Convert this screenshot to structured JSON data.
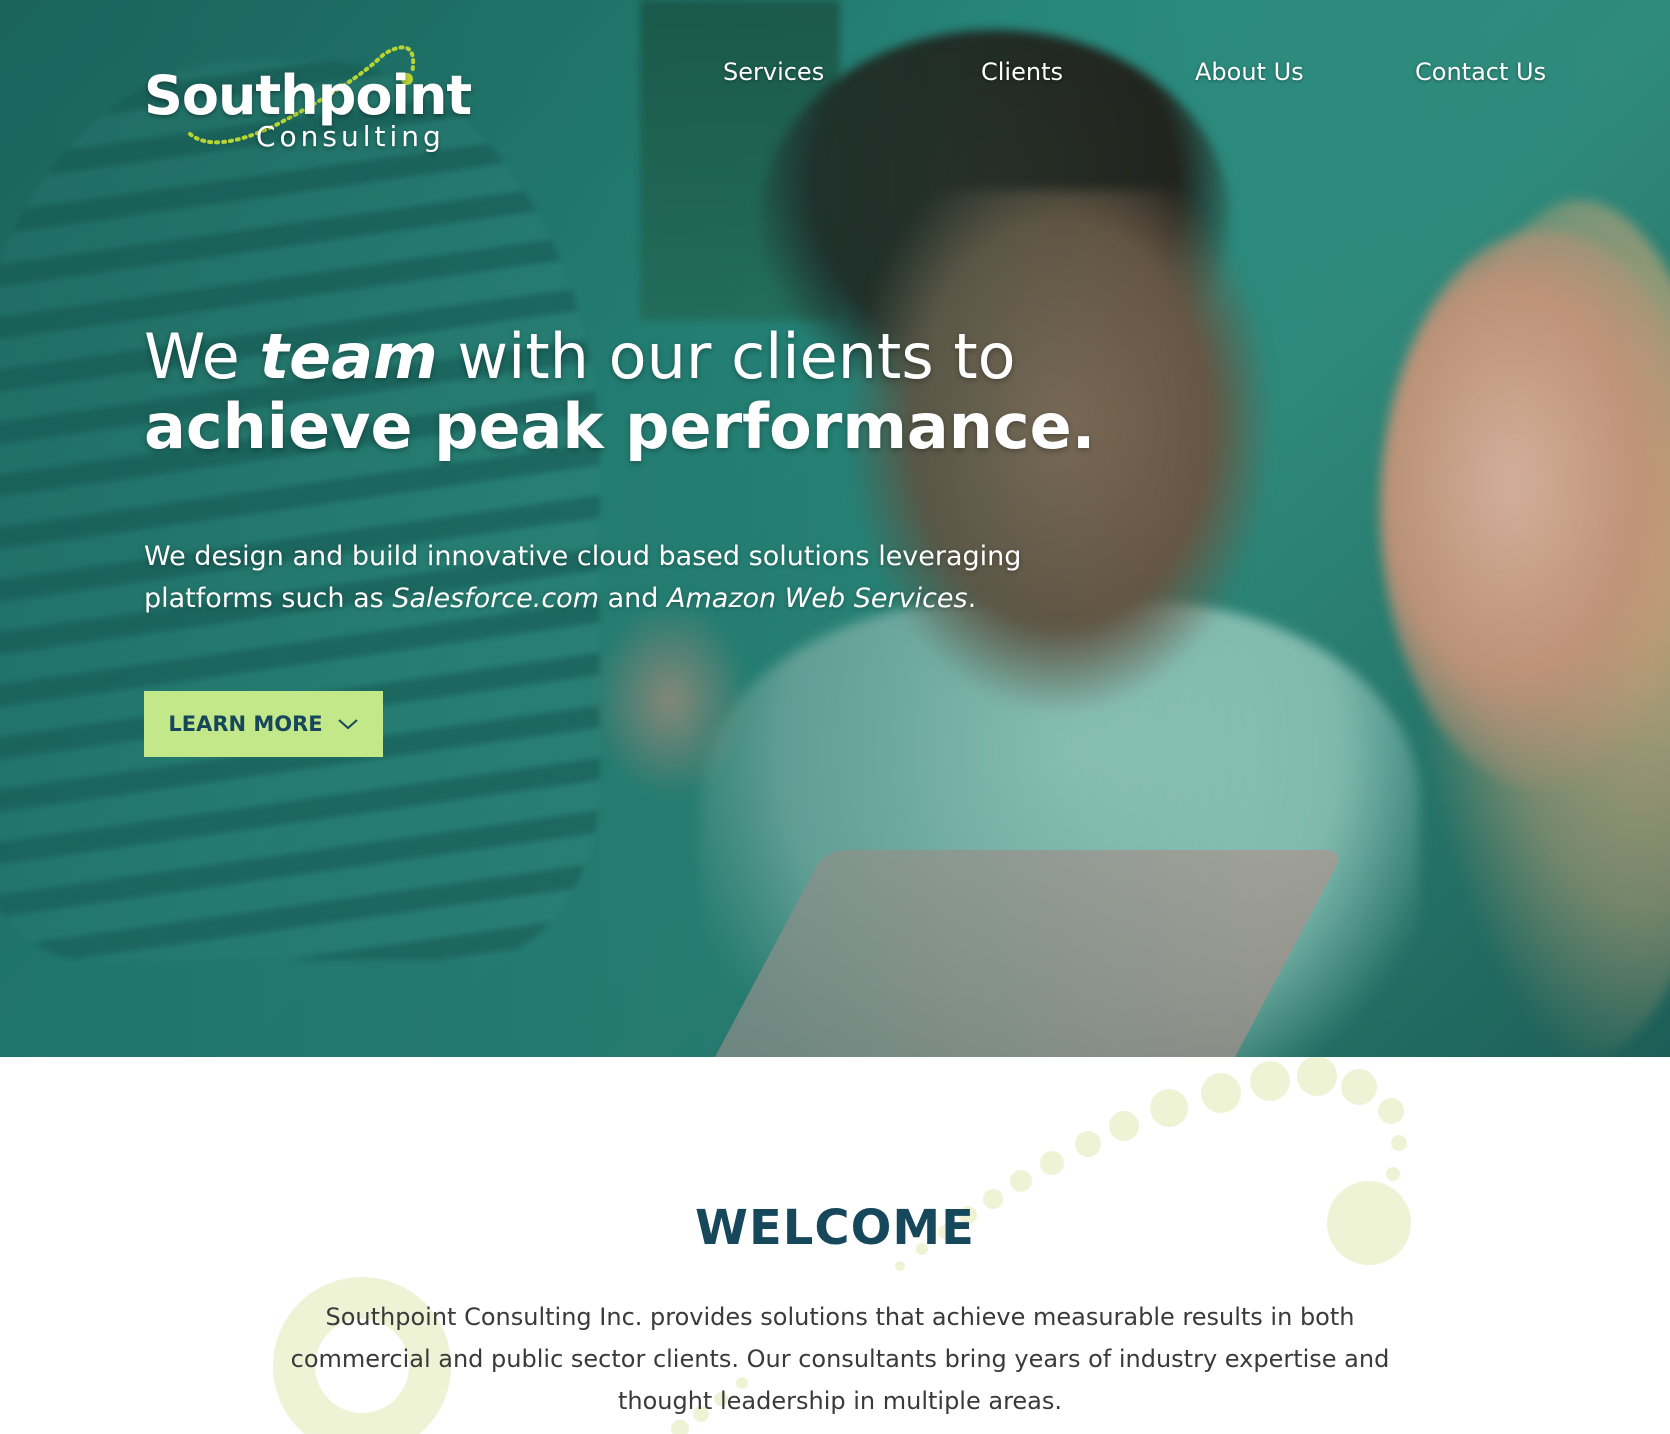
{
  "brand": {
    "name": "Southpoint",
    "tagline": "Consulting",
    "colors": {
      "accent": "#c3e88a",
      "dark_teal": "#17475a",
      "hero_tint": "#2b8f82",
      "dot_light": "#eef3d6"
    }
  },
  "nav": {
    "items": [
      "Services",
      "Clients",
      "About Us",
      "Contact Us"
    ]
  },
  "hero": {
    "headline_we": "We",
    "headline_team": "team",
    "headline_rest": "with our clients to",
    "headline_line2": "achieve peak performance.",
    "sub_line1": "We design and build innovative cloud based solutions leveraging",
    "sub_prefix": "platforms such as",
    "sub_salesforce": "Salesforce.com",
    "sub_and": "and",
    "sub_aws": "Amazon Web Services",
    "sub_period": ".",
    "cta_label": "LEARN MORE",
    "cta_icon": "chevron-down-icon"
  },
  "welcome": {
    "title": "WELCOME",
    "body": "Southpoint Consulting Inc. provides solutions that achieve measurable results in both commercial and public sector clients. Our consultants bring years of industry expertise and thought leadership in multiple areas."
  }
}
